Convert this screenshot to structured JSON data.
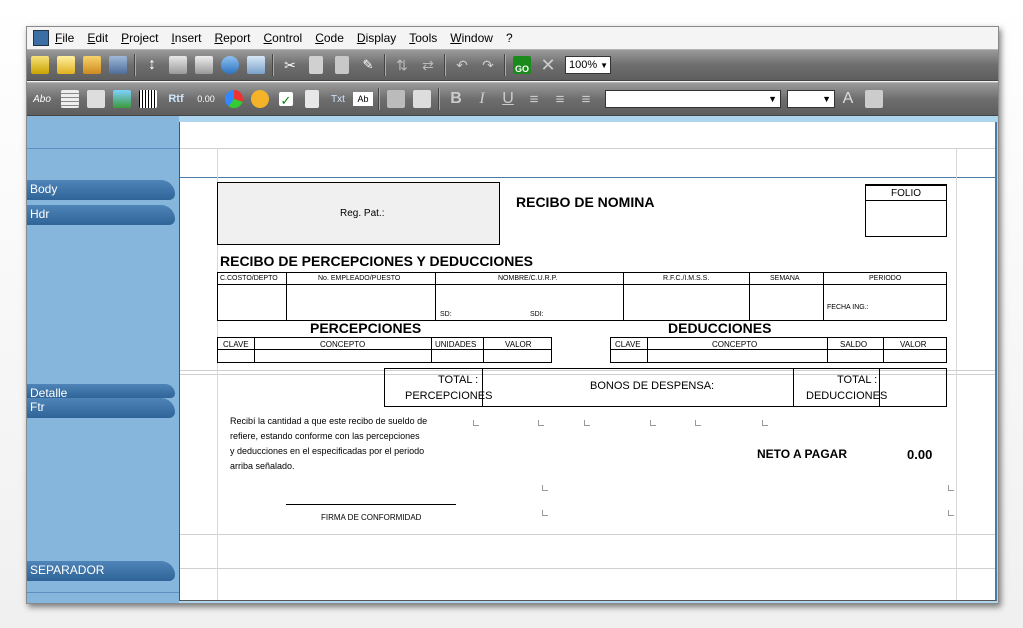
{
  "menu": [
    "File",
    "Edit",
    "Project",
    "Insert",
    "Report",
    "Control",
    "Code",
    "Display",
    "Tools",
    "Window",
    "?"
  ],
  "toolbar": {
    "zoom": "100%",
    "icons": [
      "new-report-icon",
      "open-icon",
      "image-icon",
      "save-icon",
      "spacing-icon",
      "print-icon",
      "print-preview-icon",
      "report-wizard-icon",
      "rtf-export-icon",
      "cut-icon",
      "copy-icon",
      "paste-icon",
      "paint-icon",
      "align-icon",
      "order-icon",
      "undo-icon",
      "redo-icon",
      "go-icon",
      "delete-icon"
    ]
  },
  "toolbar2": {
    "icons": [
      "label-abo-icon",
      "table-icon",
      "column-icon",
      "image-icon",
      "barcode-icon",
      "rtf-icon",
      "number-icon",
      "chart-icon",
      "shapes-icon",
      "checkbox-icon",
      "calc-icon",
      "text-icon",
      "combo-field-icon",
      "group-icon",
      "edit-icon",
      "bold-icon",
      "italic-icon",
      "underline-icon",
      "align-left-icon",
      "align-center-icon",
      "align-right-icon",
      "font-color-icon",
      "shadow-icon"
    ],
    "labels": {
      "rtf": "Rtf",
      "txt": "Txt",
      "abo": "Abo",
      "ab": "Ab",
      "num": "0.00",
      "go": "GO"
    }
  },
  "bands": [
    "Body",
    "Hdr",
    "Detalle",
    "Ftr",
    "SEPARADOR"
  ],
  "report": {
    "reg_pat": "Reg. Pat.:",
    "title": "RECIBO DE NOMINA",
    "folio": "FOLIO",
    "subtitle": "RECIBO DE PERCEPCIONES Y DEDUCCIONES",
    "cols": [
      "C.COSTO/DEPTO",
      "No. EMPLEADO/PUESTO",
      "NOMBRE/C.U.R.P.",
      "R.F.C./I.M.S.S.",
      "SEMANA",
      "PERIODO"
    ],
    "sd1": "SD:",
    "sd2": "SDI:",
    "fecha_ing": "FECHA ING.:",
    "percepciones": "PERCEPCIONES",
    "deducciones": "DEDUCCIONES",
    "perc_cols": [
      "CLAVE",
      "CONCEPTO",
      "UNIDADES",
      "VALOR"
    ],
    "ded_cols": [
      "CLAVE",
      "CONCEPTO",
      "SALDO",
      "VALOR"
    ],
    "total_perc_1": "TOTAL :",
    "total_perc_2": "PERCEPCIONES",
    "bonos": "BONOS DE DESPENSA:",
    "total_ded_1": "TOTAL :",
    "total_ded_2": "DEDUCCIONES",
    "recibi": [
      "Recibí la cantidad a que este recibo de sueldo de",
      "refiere, estando conforme con las percepciones",
      "y deducciones en el especificadas por  el periodo",
      "arriba señalado."
    ],
    "neto": "NETO A PAGAR",
    "neto_val": "0.00",
    "firma": "FIRMA DE CONFORMIDAD"
  }
}
